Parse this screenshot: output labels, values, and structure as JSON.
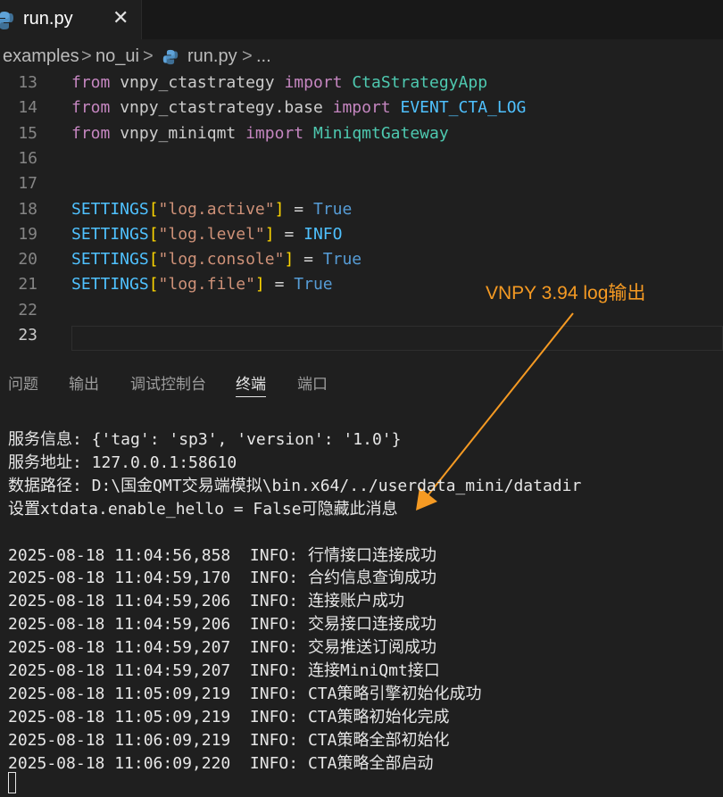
{
  "tab": {
    "label": "run.py",
    "close": "✕"
  },
  "breadcrumb": {
    "items": [
      "examples",
      "no_ui",
      "run.py",
      "..."
    ],
    "sep": ">"
  },
  "editor": {
    "lines": [
      {
        "num": "13",
        "tokens": [
          [
            "k",
            "from"
          ],
          [
            "op",
            " "
          ],
          [
            "mod",
            "vnpy_ctastrategy"
          ],
          [
            "op",
            " "
          ],
          [
            "k",
            "import"
          ],
          [
            "op",
            " "
          ],
          [
            "ns",
            "CtaStrategyApp"
          ]
        ]
      },
      {
        "num": "14",
        "tokens": [
          [
            "k",
            "from"
          ],
          [
            "op",
            " "
          ],
          [
            "mod",
            "vnpy_ctastrategy.base"
          ],
          [
            "op",
            " "
          ],
          [
            "k",
            "import"
          ],
          [
            "op",
            " "
          ],
          [
            "var",
            "EVENT_CTA_LOG"
          ]
        ]
      },
      {
        "num": "15",
        "tokens": [
          [
            "k",
            "from"
          ],
          [
            "op",
            " "
          ],
          [
            "mod",
            "vnpy_miniqmt"
          ],
          [
            "op",
            " "
          ],
          [
            "k",
            "import"
          ],
          [
            "op",
            " "
          ],
          [
            "ns",
            "MiniqmtGateway"
          ]
        ]
      },
      {
        "num": "16",
        "tokens": []
      },
      {
        "num": "17",
        "tokens": []
      },
      {
        "num": "18",
        "tokens": [
          [
            "var",
            "SETTINGS"
          ],
          [
            "br",
            "["
          ],
          [
            "str",
            "\"log.active\""
          ],
          [
            "br",
            "]"
          ],
          [
            "op",
            " = "
          ],
          [
            "bool",
            "True"
          ]
        ]
      },
      {
        "num": "19",
        "tokens": [
          [
            "var",
            "SETTINGS"
          ],
          [
            "br",
            "["
          ],
          [
            "str",
            "\"log.level\""
          ],
          [
            "br",
            "]"
          ],
          [
            "op",
            " = "
          ],
          [
            "var",
            "INFO"
          ]
        ]
      },
      {
        "num": "20",
        "tokens": [
          [
            "var",
            "SETTINGS"
          ],
          [
            "br",
            "["
          ],
          [
            "str",
            "\"log.console\""
          ],
          [
            "br",
            "]"
          ],
          [
            "op",
            " = "
          ],
          [
            "bool",
            "True"
          ]
        ]
      },
      {
        "num": "21",
        "tokens": [
          [
            "var",
            "SETTINGS"
          ],
          [
            "br",
            "["
          ],
          [
            "str",
            "\"log.file\""
          ],
          [
            "br",
            "]"
          ],
          [
            "op",
            " = "
          ],
          [
            "bool",
            "True"
          ]
        ]
      },
      {
        "num": "22",
        "tokens": []
      },
      {
        "num": "23",
        "tokens": []
      }
    ],
    "active_line": "23"
  },
  "annotation": {
    "text": "VNPY 3.94 log输出",
    "color": "#f59a23"
  },
  "panel": {
    "tabs": [
      "问题",
      "输出",
      "调试控制台",
      "终端",
      "端口"
    ],
    "active": "终端"
  },
  "terminal": {
    "lines": [
      "服务信息: {'tag': 'sp3', 'version': '1.0'}",
      "服务地址: 127.0.0.1:58610",
      "数据路径: D:\\国金QMT交易端模拟\\bin.x64/../userdata_mini/datadir",
      "设置xtdata.enable_hello = False可隐藏此消息",
      "",
      "2025-08-18 11:04:56,858  INFO: 行情接口连接成功",
      "2025-08-18 11:04:59,170  INFO: 合约信息查询成功",
      "2025-08-18 11:04:59,206  INFO: 连接账户成功",
      "2025-08-18 11:04:59,206  INFO: 交易接口连接成功",
      "2025-08-18 11:04:59,207  INFO: 交易推送订阅成功",
      "2025-08-18 11:04:59,207  INFO: 连接MiniQmt接口",
      "2025-08-18 11:05:09,219  INFO: CTA策略引擎初始化成功",
      "2025-08-18 11:05:09,219  INFO: CTA策略初始化完成",
      "2025-08-18 11:06:09,219  INFO: CTA策略全部初始化",
      "2025-08-18 11:06:09,220  INFO: CTA策略全部启动"
    ]
  }
}
